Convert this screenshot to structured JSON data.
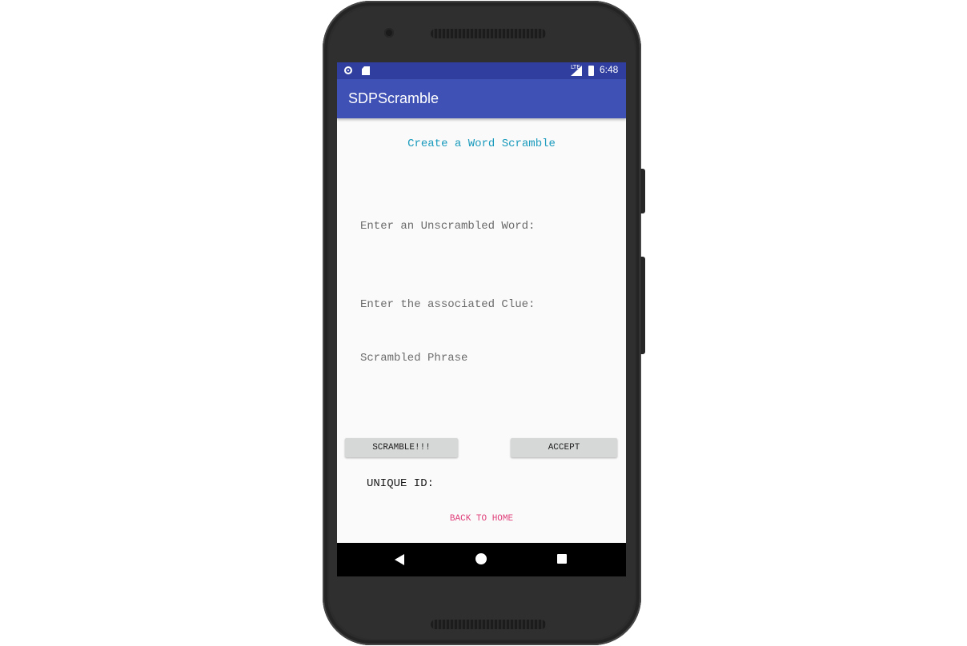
{
  "status_bar": {
    "time": "6:48",
    "network_label": "LTE",
    "icons": [
      "record-icon",
      "sd-card-icon",
      "signal-icon",
      "battery-icon"
    ]
  },
  "app_bar": {
    "title": "SDPScramble",
    "color": "#3f51b5"
  },
  "content": {
    "heading": "Create a Word Scramble",
    "word_field_hint": "Enter an Unscrambled Word:",
    "clue_field_hint": "Enter the associated Clue:",
    "scrambled_phrase_label": "Scrambled Phrase",
    "scramble_button": "SCRAMBLE!!!",
    "accept_button": "ACCEPT",
    "unique_id_label": "UNIQUE ID:",
    "back_to_home": "BACK TO HOME"
  },
  "nav_bar": {
    "icons": [
      "back-icon",
      "home-icon",
      "recents-icon"
    ]
  },
  "colors": {
    "status_bar": "#303f9f",
    "heading_text": "#1a9bbd",
    "link_text": "#e0407b"
  }
}
